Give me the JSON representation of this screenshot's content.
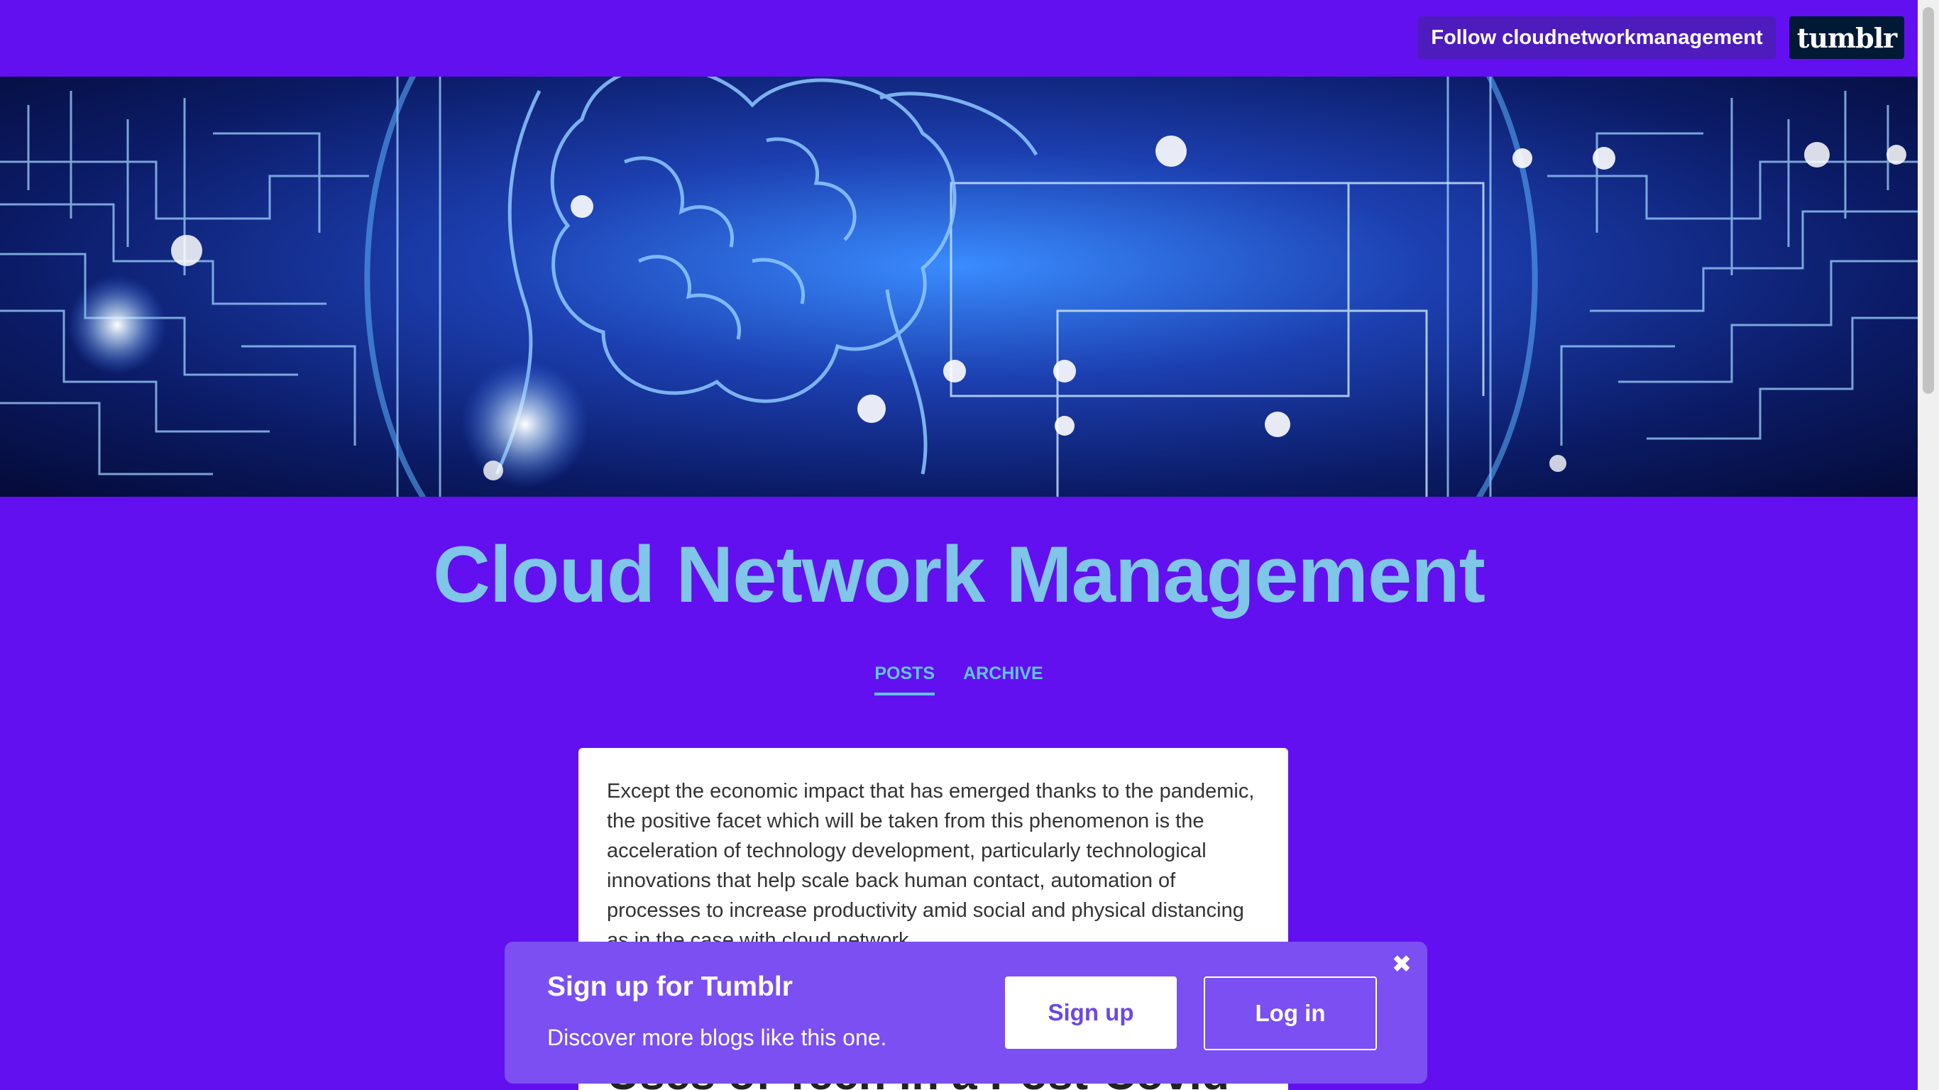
{
  "topbar": {
    "follow_label": "Follow cloudnetworkmanagement",
    "logo_text": "tumblr"
  },
  "blog": {
    "title": "Cloud Network Management"
  },
  "nav": {
    "tabs": [
      {
        "label": "POSTS",
        "active": true
      },
      {
        "label": "ARCHIVE",
        "active": false
      }
    ]
  },
  "post": {
    "text": "Except the economic impact that has emerged thanks to the pandemic, the positive facet which will be taken from this phenomenon is the acceleration of technology development, particularly technological innovations that help scale back human contact, automation of processes to increase productivity amid social and physical distancing as in the case with cloud network",
    "heading_partial": "Uses of Tech in a Post-Covid"
  },
  "signup_banner": {
    "title": "Sign up for Tumblr",
    "subtitle": "Discover more blogs like this one.",
    "signup_label": "Sign up",
    "login_label": "Log in",
    "close_icon": "close-icon"
  },
  "colors": {
    "background": "#6210ef",
    "title": "#7fc6e8",
    "tab": "#60c5e8",
    "banner": "#7b4ff2"
  }
}
